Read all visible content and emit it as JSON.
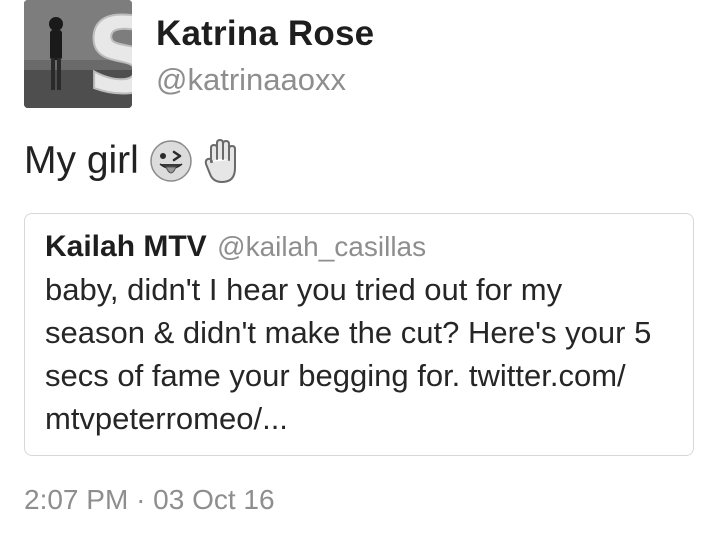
{
  "author": {
    "display_name": "Katrina Rose",
    "handle": "@katrinaaoxx",
    "avatar_icon": "profile-photo"
  },
  "tweet": {
    "text": "My girl",
    "emojis": [
      "stuck-out-tongue-winking-eye-emoji",
      "raised-hand-emoji"
    ]
  },
  "quoted_tweet": {
    "display_name": "Kailah MTV",
    "handle": "@kailah_casillas",
    "text_lines": [
      "baby, didn't I hear you tried out for my",
      "season & didn't make the cut? Here's your 5",
      "secs of fame your begging for. twitter.com/",
      "mtvpeterromeo/..."
    ]
  },
  "timestamp": {
    "time": "2:07 PM",
    "separator": "·",
    "date": "03 Oct 16"
  },
  "colors": {
    "text_primary": "#1e1e1e",
    "text_secondary": "#8e8e8e",
    "card_border": "#d8d8d8",
    "background": "#ffffff"
  }
}
